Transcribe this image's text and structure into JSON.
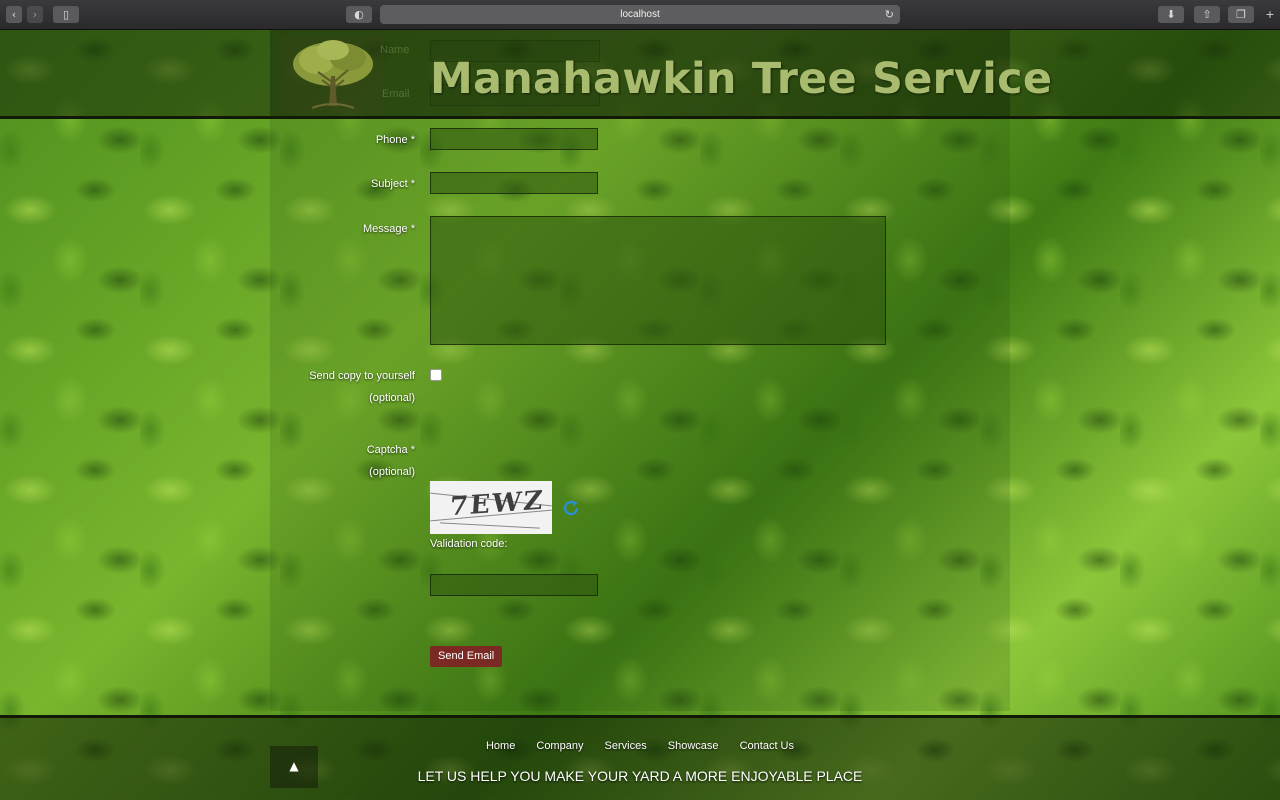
{
  "browser": {
    "url": "localhost",
    "back_icon": "chevron-left-icon",
    "forward_icon": "chevron-right-icon",
    "sidebar_icon": "sidebar-icon",
    "reader_icon": "reader-icon",
    "reload_icon": "reload-icon",
    "download_icon": "download-icon",
    "share_icon": "share-icon",
    "tabs_icon": "tabs-icon",
    "new_tab_icon": "plus-icon"
  },
  "header": {
    "title": "Manahawkin Tree Service",
    "logo_icon": "tree-icon",
    "ghost_label_name": "Name",
    "ghost_label_email": "Email"
  },
  "form": {
    "phone_label": "Phone *",
    "subject_label": "Subject *",
    "message_label": "Message *",
    "copy_label": "Send copy to yourself",
    "copy_optional": "(optional)",
    "captcha_label": "Captcha *",
    "captcha_optional": "(optional)",
    "captcha_text": "7EWZ",
    "validation_label": "Validation code:",
    "send_button": "Send Email",
    "phone_value": "",
    "subject_value": "",
    "message_value": "",
    "validation_value": ""
  },
  "footer": {
    "nav": [
      "Home",
      "Company",
      "Services",
      "Showcase",
      "Contact Us"
    ],
    "tagline": "LET US HELP YOU MAKE YOUR YARD A MORE ENJOYABLE PLACE",
    "to_top_icon": "arrow-up-icon"
  },
  "colors": {
    "title": "#a8bb6e",
    "send_button": "#7a2a22",
    "header_band": "#101a06"
  }
}
